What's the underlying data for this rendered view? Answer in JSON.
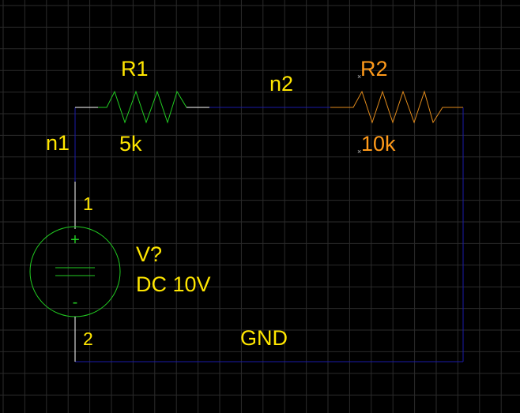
{
  "colors": {
    "background": "#000000",
    "grid": "#2b2b2b",
    "wire": "#1a1aa8",
    "r1": "#22cc22",
    "r2": "#e08a1c",
    "source": "#22cc22",
    "label_yellow": "#ffe600",
    "label_orange": "#ff9a1a",
    "pin_white": "#ffffff",
    "marker": "#bbbbbb"
  },
  "components": {
    "r1": {
      "name": "R1",
      "value": "5k"
    },
    "r2": {
      "name": "R2",
      "value": "10k"
    },
    "source": {
      "name": "V?",
      "value": "DC 10V",
      "pin_pos": "1",
      "pin_neg": "2",
      "plus": "+",
      "minus": "-"
    }
  },
  "nets": {
    "n1": "n1",
    "n2": "n2",
    "gnd": "GND"
  }
}
